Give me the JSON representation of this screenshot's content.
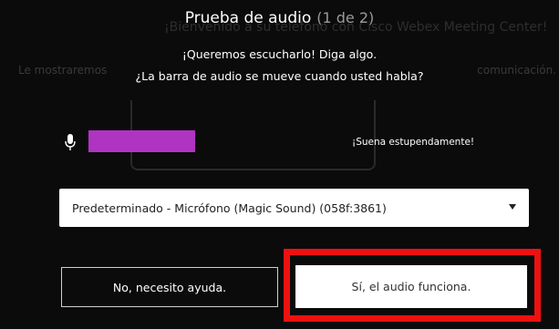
{
  "header": {
    "title": "Prueba de audio",
    "step": "(1 de 2)",
    "prompt": "¡Queremos escucharlo! Diga algo.",
    "question": "¿La barra de audio se mueve cuando usted habla?"
  },
  "background_text": {
    "line1": "¡Bienvenido a su teléfono con Cisco Webex Meeting Center!",
    "line2_left": "Le mostraremos",
    "line2_right": "comunicación."
  },
  "audio_level": {
    "level_fraction": 0.23,
    "bar_color": "#b034c2",
    "status": "¡Suena estupendamente!"
  },
  "device_select": {
    "selected": "Predeterminado - Micrófono (Magic Sound) (058f:3861)"
  },
  "buttons": {
    "no_label": "No, necesito ayuda.",
    "yes_label": "Sí, el audio funciona."
  },
  "annotation": {
    "highlight_color": "#ee1111"
  }
}
